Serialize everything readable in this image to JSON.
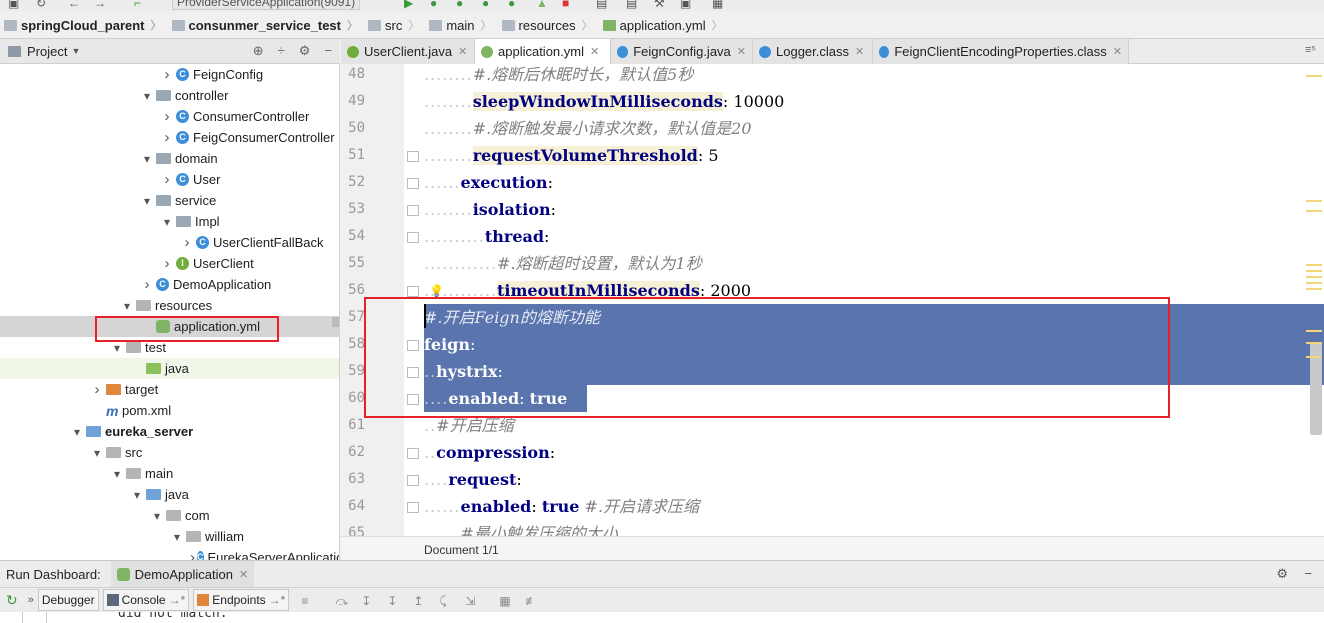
{
  "topbar": {
    "run_config": "ProviderServiceApplication(9091)"
  },
  "breadcrumbs": [
    {
      "label": "springCloud_parent",
      "bold": true
    },
    {
      "label": "consunmer_service_test",
      "bold": true
    },
    {
      "label": "src",
      "bold": false
    },
    {
      "label": "main",
      "bold": false
    },
    {
      "label": "resources",
      "bold": false
    },
    {
      "label": "application.yml",
      "bold": false
    }
  ],
  "project_panel": {
    "title": "Project"
  },
  "tree": [
    {
      "label": "FeignConfig",
      "icon": "class",
      "depth": 3,
      "arrow": "right"
    },
    {
      "label": "controller",
      "icon": "folder",
      "depth": 2,
      "arrow": "down"
    },
    {
      "label": "ConsumerController",
      "icon": "class",
      "depth": 3,
      "arrow": "right"
    },
    {
      "label": "FeigConsumerController",
      "icon": "class",
      "depth": 3,
      "arrow": "right"
    },
    {
      "label": "domain",
      "icon": "folder",
      "depth": 2,
      "arrow": "down"
    },
    {
      "label": "User",
      "icon": "class",
      "depth": 3,
      "arrow": "right"
    },
    {
      "label": "service",
      "icon": "folder",
      "depth": 2,
      "arrow": "down"
    },
    {
      "label": "Impl",
      "icon": "folder",
      "depth": 3,
      "arrow": "down"
    },
    {
      "label": "UserClientFallBack",
      "icon": "class",
      "depth": 4,
      "arrow": "right"
    },
    {
      "label": "UserClient",
      "icon": "iface",
      "depth": 3,
      "arrow": "right"
    },
    {
      "label": "DemoApplication",
      "icon": "class",
      "depth": 2,
      "arrow": "right"
    },
    {
      "label": "resources",
      "icon": "folder-grey",
      "depth": 1,
      "arrow": "down"
    },
    {
      "label": "application.yml",
      "icon": "yml",
      "depth": 2,
      "arrow": "",
      "selected": true
    },
    {
      "label": "test",
      "icon": "folder-grey",
      "depth": 0.5,
      "arrow": "down"
    },
    {
      "label": "java",
      "icon": "folder-green",
      "depth": 1.5,
      "arrow": "",
      "green": true
    },
    {
      "label": "target",
      "icon": "folder-orange",
      "depth": -0.5,
      "arrow": "right"
    },
    {
      "label": "pom.xml",
      "icon": "mvn",
      "depth": -0.5,
      "arrow": ""
    },
    {
      "label": "eureka_server",
      "icon": "folder-blue",
      "depth": -1.5,
      "arrow": "down",
      "bold": true
    },
    {
      "label": "src",
      "icon": "folder-grey",
      "depth": -0.5,
      "arrow": "down"
    },
    {
      "label": "main",
      "icon": "folder-grey",
      "depth": 0.5,
      "arrow": "down"
    },
    {
      "label": "java",
      "icon": "folder-blue",
      "depth": 1.5,
      "arrow": "down"
    },
    {
      "label": "com",
      "icon": "folder-grey",
      "depth": 2.5,
      "arrow": "down"
    },
    {
      "label": "william",
      "icon": "folder-grey",
      "depth": 3.5,
      "arrow": "down"
    },
    {
      "label": "EurekaServerApplication",
      "icon": "class",
      "depth": 4.5,
      "arrow": "right"
    }
  ],
  "tabs": [
    {
      "label": "UserClient.java",
      "icon_color": "#6fae3c",
      "active": false
    },
    {
      "label": "application.yml",
      "icon_color": "#7fb565",
      "active": true
    },
    {
      "label": "FeignConfig.java",
      "icon_color": "#3d8ed9",
      "active": false
    },
    {
      "label": "Logger.class",
      "icon_color": "#3d8ed9",
      "active": false
    },
    {
      "label": "FeignClientEncodingProperties.class",
      "icon_color": "#3d8ed9",
      "active": false
    }
  ],
  "code": [
    {
      "n": "48",
      "indent": 4,
      "parts": [
        {
          "t": "c",
          "s": "#.熔断后休眠时长，默认值5秒"
        }
      ]
    },
    {
      "n": "49",
      "indent": 4,
      "parts": [
        {
          "t": "kh",
          "s": "sleepWindowInMilliseconds"
        },
        {
          "t": "v",
          "s": ": 10000"
        }
      ]
    },
    {
      "n": "50",
      "indent": 4,
      "parts": [
        {
          "t": "c",
          "s": "#.熔断触发最小请求次数，默认值是20"
        }
      ]
    },
    {
      "n": "51",
      "indent": 4,
      "parts": [
        {
          "t": "kh",
          "s": "requestVolumeThreshold"
        },
        {
          "t": "v",
          "s": ": 5"
        }
      ]
    },
    {
      "n": "52",
      "indent": 3,
      "parts": [
        {
          "t": "k",
          "s": "execution"
        },
        {
          "t": "v",
          "s": ":"
        }
      ]
    },
    {
      "n": "53",
      "indent": 4,
      "parts": [
        {
          "t": "k",
          "s": "isolation"
        },
        {
          "t": "v",
          "s": ":"
        }
      ]
    },
    {
      "n": "54",
      "indent": 5,
      "parts": [
        {
          "t": "k",
          "s": "thread"
        },
        {
          "t": "v",
          "s": ":"
        }
      ]
    },
    {
      "n": "55",
      "indent": 6,
      "parts": [
        {
          "t": "c",
          "s": "#.熔断超时设置，默认为1秒"
        }
      ]
    },
    {
      "n": "56",
      "indent": 6,
      "parts": [
        {
          "t": "kh",
          "s": "timeoutInMilliseconds"
        },
        {
          "t": "v",
          "s": ": 2000"
        }
      ]
    },
    {
      "n": "57",
      "indent": 0,
      "sel": "full",
      "parts": [
        {
          "t": "c",
          "s": "#.开启Feign的熔断功能"
        }
      ]
    },
    {
      "n": "58",
      "indent": 0,
      "sel": "full",
      "parts": [
        {
          "t": "k",
          "s": "feign"
        },
        {
          "t": "v",
          "s": ":"
        }
      ]
    },
    {
      "n": "59",
      "indent": 1,
      "sel": "full",
      "parts": [
        {
          "t": "k",
          "s": "hystrix"
        },
        {
          "t": "v",
          "s": ":"
        }
      ]
    },
    {
      "n": "60",
      "indent": 2,
      "sel": "part",
      "parts": [
        {
          "t": "k",
          "s": "enabled"
        },
        {
          "t": "v",
          "s": ": "
        },
        {
          "t": "b",
          "s": "true"
        }
      ]
    },
    {
      "n": "61",
      "indent": 1,
      "parts": [
        {
          "t": "c",
          "s": "#开启压缩"
        }
      ]
    },
    {
      "n": "62",
      "indent": 1,
      "parts": [
        {
          "t": "k",
          "s": "compression"
        },
        {
          "t": "v",
          "s": ":"
        }
      ]
    },
    {
      "n": "63",
      "indent": 2,
      "parts": [
        {
          "t": "k",
          "s": "request"
        },
        {
          "t": "v",
          "s": ":"
        }
      ]
    },
    {
      "n": "64",
      "indent": 3,
      "parts": [
        {
          "t": "k",
          "s": "enabled"
        },
        {
          "t": "v",
          "s": ": "
        },
        {
          "t": "b",
          "s": "true"
        },
        {
          "t": "c",
          "s": " #.开启请求压缩"
        }
      ]
    },
    {
      "n": "65",
      "indent": 3,
      "parts": [
        {
          "t": "c",
          "s": "#最小触发压缩的大小"
        }
      ]
    }
  ],
  "status": {
    "document": "Document 1/1"
  },
  "run_dashboard": {
    "label": "Run Dashboard:",
    "tab": "DemoApplication"
  },
  "run_toolbar": {
    "debugger": "Debugger",
    "console": "Console",
    "endpoints": "Endpoints"
  },
  "console": {
    "text": "did not match:"
  },
  "colors": {
    "selection": "#5a74ad",
    "annotation": "#e8202a",
    "key": "#000080",
    "comment": "#808080"
  }
}
